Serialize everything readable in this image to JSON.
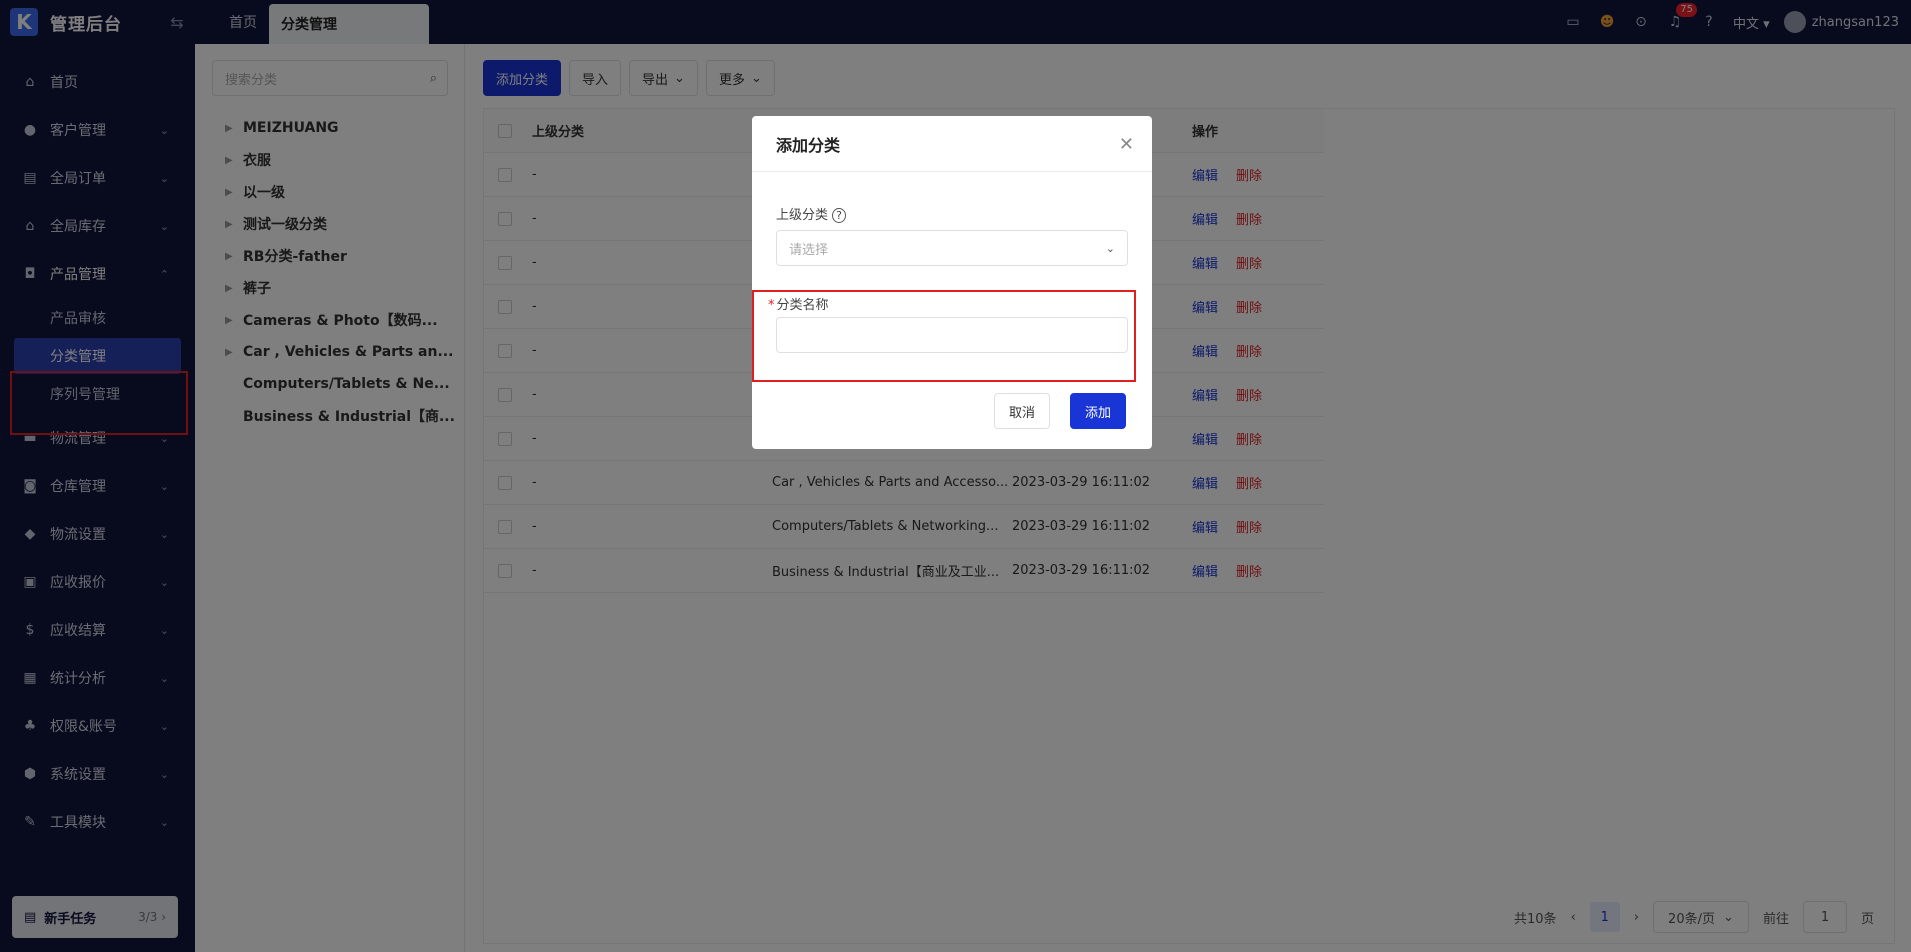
{
  "topbar": {
    "logo_text": "管理后台",
    "tabs": [
      "首页",
      "分类管理"
    ],
    "notification_count": "75",
    "language": "中文",
    "username": "zhangsan123"
  },
  "sidebar": {
    "items": [
      {
        "label": "首页",
        "icon": "home-icon"
      },
      {
        "label": "客户管理",
        "icon": "users-icon"
      },
      {
        "label": "全局订单",
        "icon": "clipboard-icon"
      },
      {
        "label": "全局库存",
        "icon": "warehouse-icon"
      },
      {
        "label": "产品管理",
        "icon": "bag-icon"
      },
      {
        "label": "物流管理",
        "icon": "truck-icon"
      },
      {
        "label": "仓库管理",
        "icon": "car-icon"
      },
      {
        "label": "物流设置",
        "icon": "box-icon"
      },
      {
        "label": "应收报价",
        "icon": "document-icon"
      },
      {
        "label": "应收结算",
        "icon": "coin-icon"
      },
      {
        "label": "统计分析",
        "icon": "chart-icon"
      },
      {
        "label": "权限&账号",
        "icon": "org-icon"
      },
      {
        "label": "系统设置",
        "icon": "gear-icon"
      },
      {
        "label": "工具模块",
        "icon": "wrench-icon"
      }
    ],
    "product_sub": [
      "产品审核",
      "分类管理",
      "序列号管理"
    ],
    "task_label": "新手任务",
    "task_count": "3/3"
  },
  "tree": {
    "search_placeholder": "搜索分类",
    "nodes": [
      {
        "label": "MEIZHUANG",
        "leaf": false
      },
      {
        "label": "衣服",
        "leaf": false
      },
      {
        "label": "以一级",
        "leaf": false
      },
      {
        "label": "测试一级分类",
        "leaf": false
      },
      {
        "label": "RB分类-father",
        "leaf": false
      },
      {
        "label": "裤子",
        "leaf": false
      },
      {
        "label": "Cameras & Photo【数码...",
        "leaf": false
      },
      {
        "label": "Car , Vehicles & Parts an...",
        "leaf": false
      },
      {
        "label": "Computers/Tablets & Ne...",
        "leaf": true
      },
      {
        "label": "Business & Industrial【商...",
        "leaf": true
      }
    ]
  },
  "toolbar": {
    "add": "添加分类",
    "import": "导入",
    "export": "导出",
    "more": "更多"
  },
  "table": {
    "headers": {
      "parent": "上级分类",
      "ops": "操作"
    },
    "edit_label": "编辑",
    "delete_label": "删除",
    "rows": [
      {
        "parent": "-",
        "name": "",
        "time": ""
      },
      {
        "parent": "-",
        "name": "",
        "time": ""
      },
      {
        "parent": "-",
        "name": "",
        "time": ""
      },
      {
        "parent": "-",
        "name": "",
        "time": ""
      },
      {
        "parent": "-",
        "name": "",
        "time": ""
      },
      {
        "parent": "-",
        "name": "",
        "time": ""
      },
      {
        "parent": "-",
        "name": "",
        "time": ""
      },
      {
        "parent": "-",
        "name": "Car , Vehicles & Parts and Accesso...",
        "time": "2023-03-29 16:11:02"
      },
      {
        "parent": "-",
        "name": "Computers/Tablets & Networking...",
        "time": "2023-03-29 16:11:02"
      },
      {
        "parent": "-",
        "name": "Business & Industrial【商业及工业...",
        "time": "2023-03-29 16:11:02"
      }
    ]
  },
  "pagination": {
    "total": "共10条",
    "current_page": "1",
    "page_size": "20条/页",
    "goto_prefix": "前往",
    "goto_value": "1",
    "goto_suffix": "页"
  },
  "modal": {
    "title": "添加分类",
    "parent_label": "上级分类",
    "parent_placeholder": "请选择",
    "name_label": "分类名称",
    "cancel": "取消",
    "confirm": "添加"
  },
  "colors": {
    "brand": "#1a35d6",
    "sidebar_bg": "#10153b",
    "highlight": "#e02020"
  }
}
